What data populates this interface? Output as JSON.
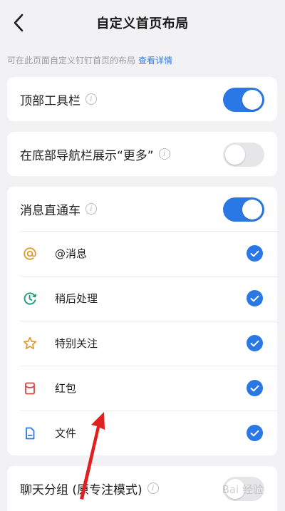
{
  "header": {
    "title": "自定义首页布局"
  },
  "hint": {
    "text": "可在此页面自定义钉钉首页的布局",
    "link": "查看详情"
  },
  "settings": {
    "top_toolbar": {
      "label": "顶部工具栏",
      "enabled": true
    },
    "bottom_more": {
      "label": "在底部导航栏展示“更多”",
      "enabled": false
    },
    "message_express": {
      "label": "消息直通车",
      "enabled": true,
      "items": [
        {
          "label": "@消息",
          "icon": "at-icon",
          "checked": true
        },
        {
          "label": "稍后处理",
          "icon": "clock-icon",
          "checked": true
        },
        {
          "label": "特别关注",
          "icon": "star-icon",
          "checked": true
        },
        {
          "label": "红包",
          "icon": "red-packet-icon",
          "checked": true
        },
        {
          "label": "文件",
          "icon": "file-icon",
          "checked": true
        }
      ]
    },
    "chat_group": {
      "label": "聊天分组 (原专注模式)"
    }
  },
  "watermark": {
    "text": "Bai 经验"
  },
  "colors": {
    "accent": "#2a78e6",
    "background": "#f2f2f4",
    "annotation_arrow": "#e02020"
  }
}
